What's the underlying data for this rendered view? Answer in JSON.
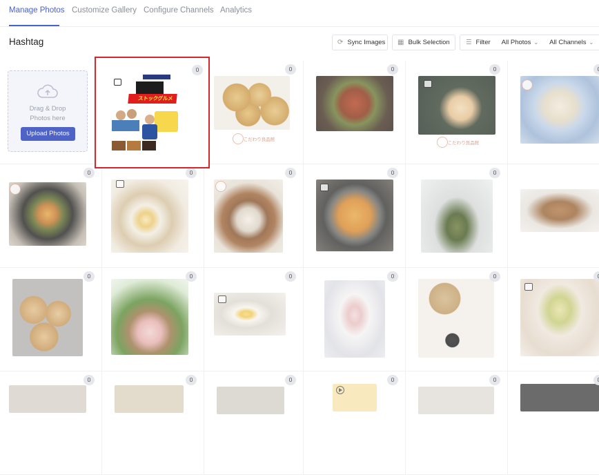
{
  "tabs": [
    {
      "label": "Manage Photos",
      "active": true
    },
    {
      "label": "Customize Gallery",
      "active": false
    },
    {
      "label": "Configure Channels",
      "active": false
    },
    {
      "label": "Analytics",
      "active": false
    }
  ],
  "header": {
    "title": "Hashtag",
    "sync_label": "Sync Images",
    "bulk_label": "Bulk Selection",
    "filter_label": "Filter",
    "photos_select": "All Photos",
    "channels_select": "All Channels"
  },
  "upload": {
    "line1": "Drag & Drop",
    "line2": "Photos here",
    "button_label": "Upload Photos"
  },
  "featured": {
    "count": "0",
    "banner_text": "ストックグルメ"
  },
  "brand_text": "こだわり良品館",
  "colors": {
    "accent": "#4a63c8",
    "upload_button": "#4f63c7",
    "selected_border": "#d7262a"
  },
  "tiles": [
    {
      "count": "0"
    },
    {
      "count": "0"
    },
    {
      "count": "0"
    },
    {
      "count": "0"
    },
    {
      "count": "0"
    },
    {
      "count": "0"
    },
    {
      "count": "0"
    },
    {
      "count": "0"
    },
    {
      "count": "0"
    },
    {
      "count": "0"
    },
    {
      "count": "0"
    },
    {
      "count": "0"
    },
    {
      "count": "0"
    },
    {
      "count": "0"
    },
    {
      "count": "0"
    },
    {
      "count": "0"
    },
    {
      "count": "0"
    },
    {
      "count": "0"
    },
    {
      "count": "0"
    },
    {
      "count": "0"
    },
    {
      "count": "0"
    },
    {
      "count": "0"
    }
  ]
}
